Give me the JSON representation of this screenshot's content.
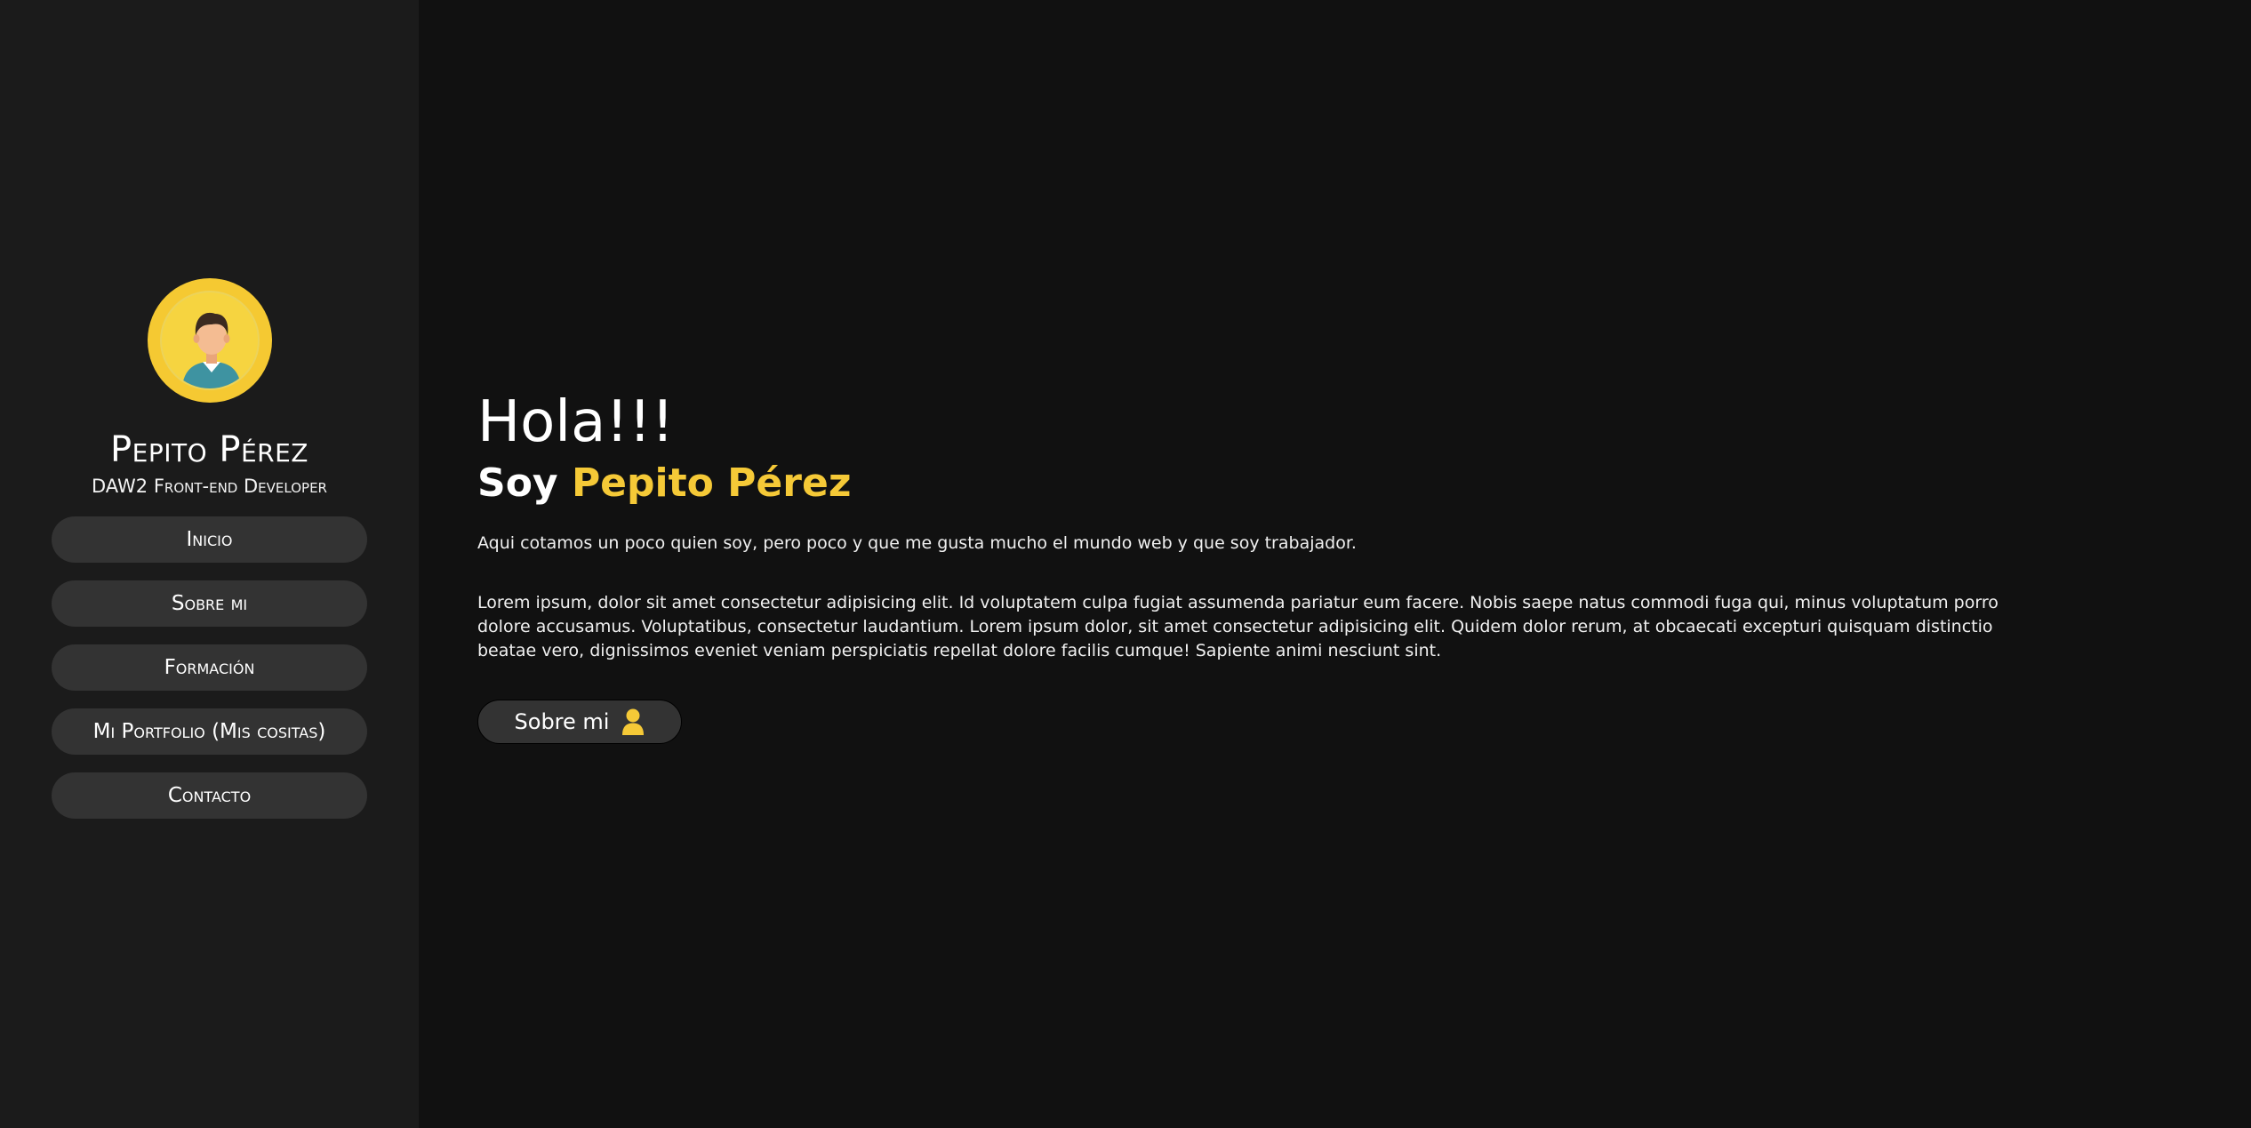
{
  "sidebar": {
    "avatar_icon": "user-avatar-illustration",
    "name": "Pepito Pérez",
    "role": "DAW2 Front-end Developer",
    "nav": [
      {
        "label": "Inicio"
      },
      {
        "label": "Sobre mi"
      },
      {
        "label": "Formación"
      },
      {
        "label": "Mi Portfolio (Mis cositas)"
      },
      {
        "label": "Contacto"
      }
    ]
  },
  "main": {
    "greeting": "Hola!!!",
    "subtitle_prefix": "Soy",
    "subtitle_name": "Pepito Pérez",
    "intro": "Aqui cotamos un poco quien soy, pero poco y que me gusta mucho el mundo web y que soy trabajador.",
    "lorem": "Lorem ipsum, dolor sit amet consectetur adipisicing elit. Id voluptatem culpa fugiat assumenda pariatur eum facere. Nobis saepe natus commodi fuga qui, minus voluptatum porro dolore accusamus. Voluptatibus, consectetur laudantium. Lorem ipsum dolor, sit amet consectetur adipisicing elit. Quidem dolor rerum, at obcaecati excepturi quisquam distinctio beatae vero, dignissimos eveniet veniam perspiciatis repellat dolore facilis cumque! Sapiente animi nesciunt sint.",
    "cta_label": "Sobre mi",
    "cta_icon": "user-icon"
  },
  "colors": {
    "accent": "#f5c937",
    "sidebar_bg": "#1b1b1b",
    "page_bg": "#111111",
    "button_bg": "#333333"
  }
}
